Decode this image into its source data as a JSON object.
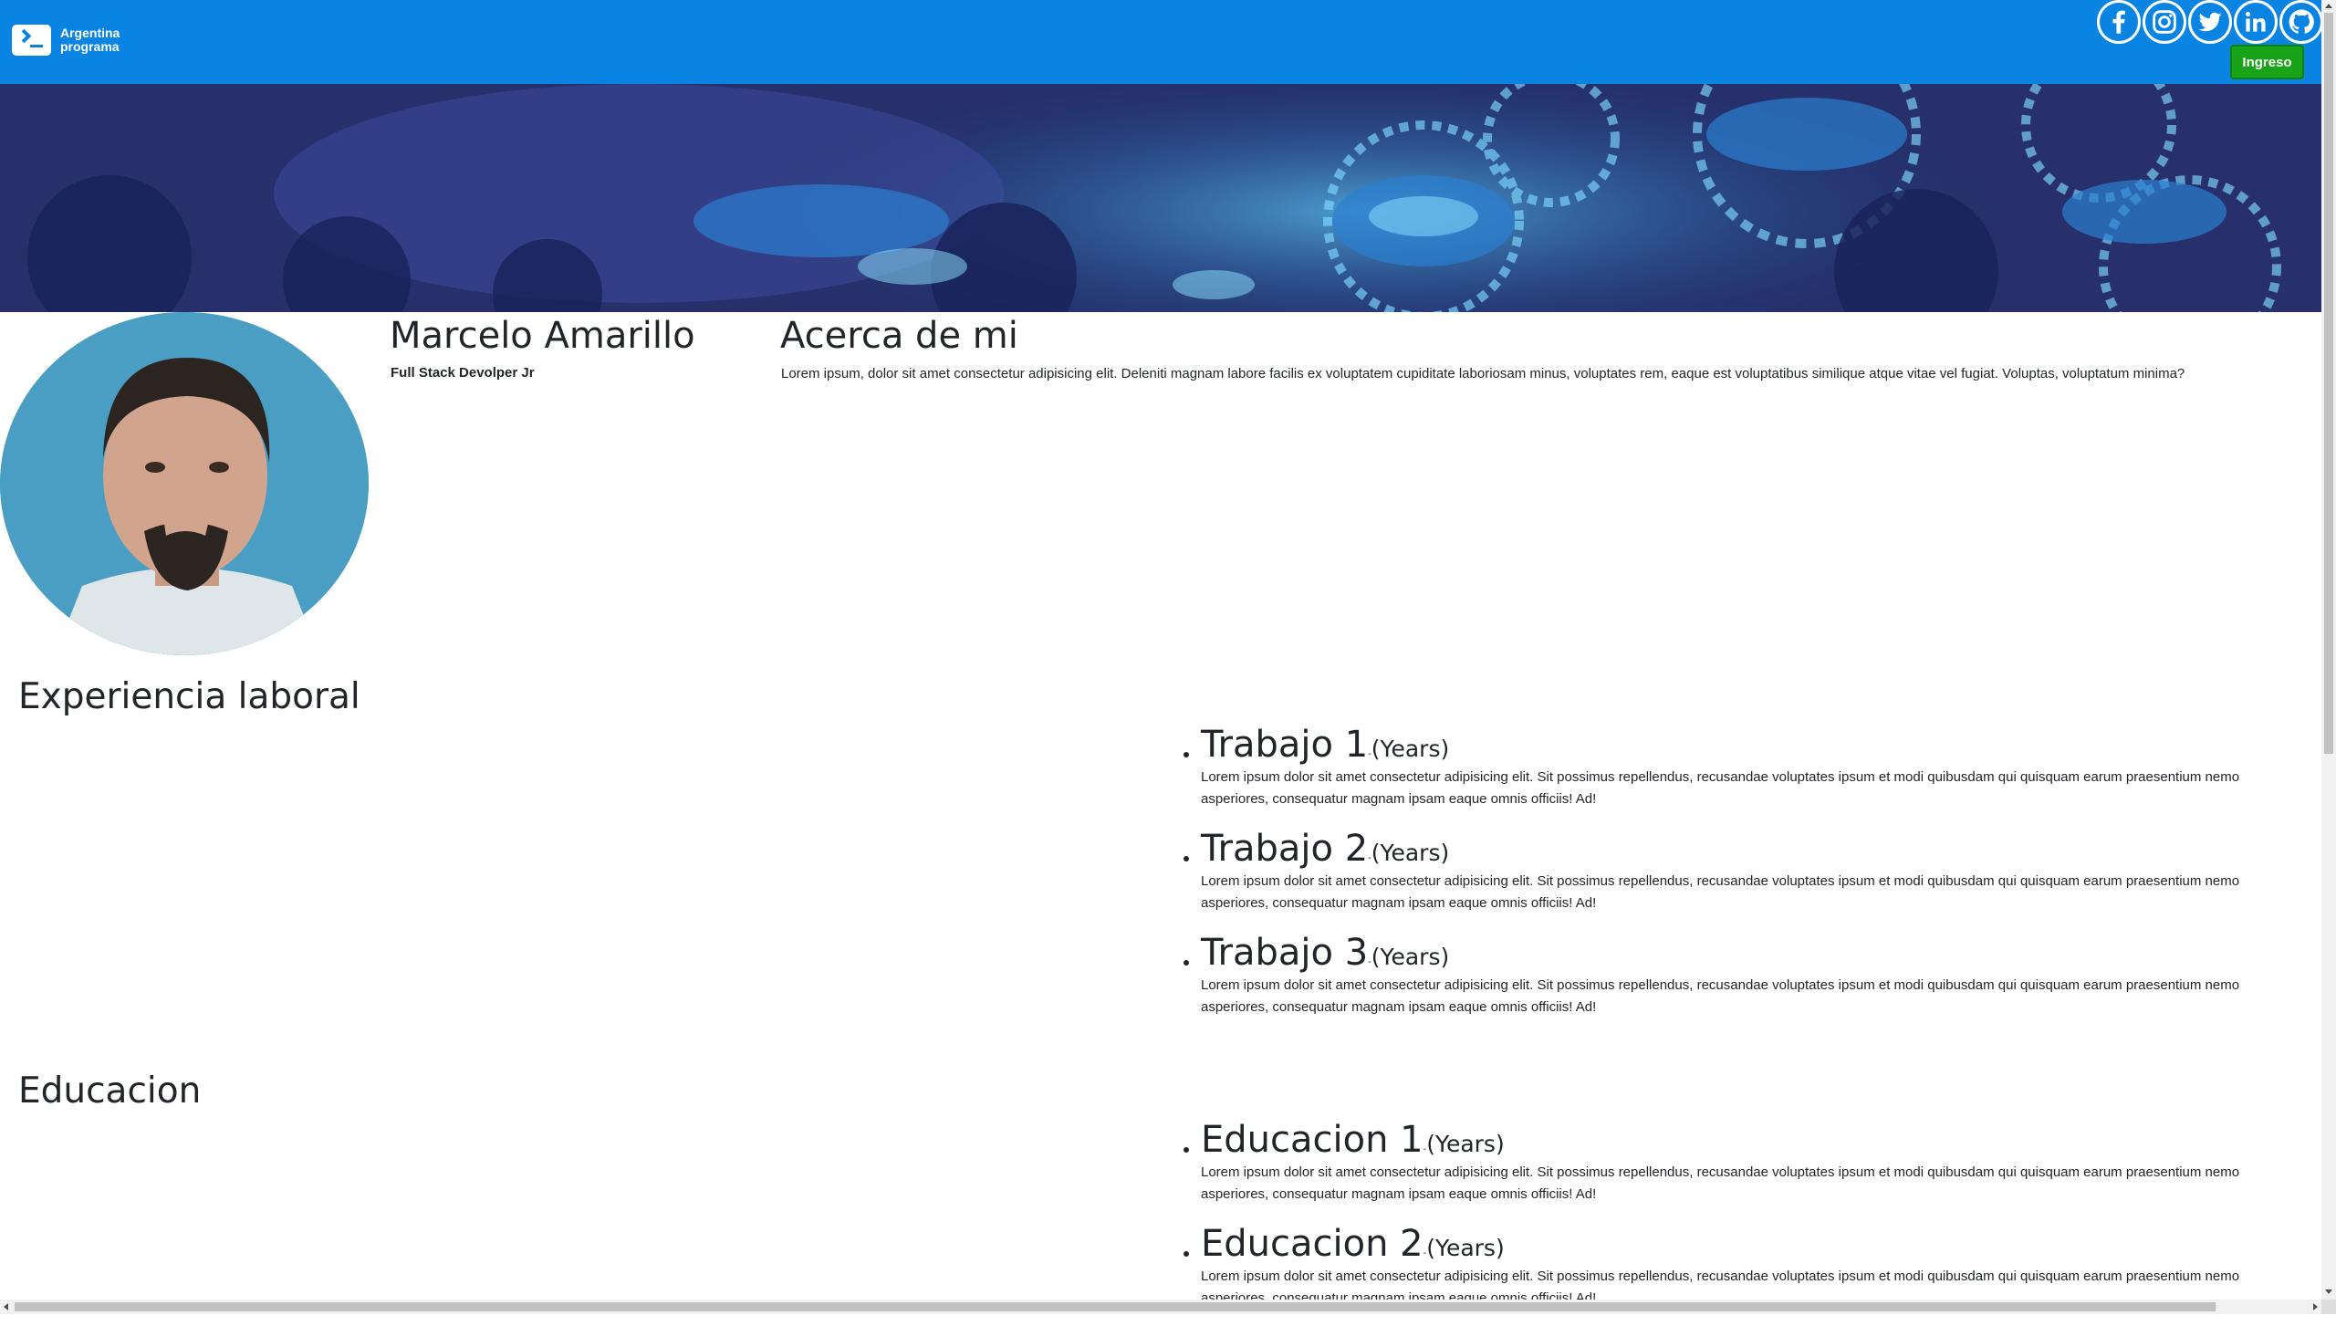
{
  "navbar": {
    "brand": "Argentina programa",
    "social": [
      "facebook-icon",
      "instagram-icon",
      "twitter-icon",
      "linkedin-icon",
      "github-icon"
    ],
    "login_label": "Ingreso",
    "colors": {
      "navbar": "#0a84e3",
      "login_button": "#19a319"
    }
  },
  "profile": {
    "name": "Marcelo Amarillo",
    "role": "Full Stack Devolper Jr"
  },
  "about": {
    "title": "Acerca de mi",
    "text": "Lorem ipsum, dolor sit amet consectetur adipisicing elit. Deleniti magnam labore facilis ex voluptatem cupiditate laboriosam minus, voluptates rem, eaque est voluptatibus similique atque vitae vel fugiat. Voluptas, voluptatum minima?"
  },
  "experience": {
    "title": "Experiencia laboral",
    "items": [
      {
        "title": "Trabajo 1",
        "dash": "-",
        "years": "(Years)",
        "desc": "Lorem ipsum dolor sit amet consectetur adipisicing elit. Sit possimus repellendus, recusandae voluptates ipsum et modi quibusdam qui quisquam earum praesentium nemo asperiores, consequatur magnam ipsam eaque omnis officiis! Ad!"
      },
      {
        "title": "Trabajo 2",
        "dash": "-",
        "years": "(Years)",
        "desc": "Lorem ipsum dolor sit amet consectetur adipisicing elit. Sit possimus repellendus, recusandae voluptates ipsum et modi quibusdam qui quisquam earum praesentium nemo asperiores, consequatur magnam ipsam eaque omnis officiis! Ad!"
      },
      {
        "title": "Trabajo 3",
        "dash": "-",
        "years": "(Years)",
        "desc": "Lorem ipsum dolor sit amet consectetur adipisicing elit. Sit possimus repellendus, recusandae voluptates ipsum et modi quibusdam qui quisquam earum praesentium nemo asperiores, consequatur magnam ipsam eaque omnis officiis! Ad!"
      }
    ]
  },
  "education": {
    "title": "Educacion",
    "items": [
      {
        "title": "Educacion 1",
        "dash": "-",
        "years": "(Years)",
        "desc": "Lorem ipsum dolor sit amet consectetur adipisicing elit. Sit possimus repellendus, recusandae voluptates ipsum et modi quibusdam qui quisquam earum praesentium nemo asperiores, consequatur magnam ipsam eaque omnis officiis! Ad!"
      },
      {
        "title": "Educacion 2",
        "dash": "-",
        "years": "(Years)",
        "desc": "Lorem ipsum dolor sit amet consectetur adipisicing elit. Sit possimus repellendus, recusandae voluptates ipsum et modi quibusdam qui quisquam earum praesentium nemo asperiores, consequatur magnam ipsam eaque omnis officiis! Ad!"
      }
    ]
  }
}
